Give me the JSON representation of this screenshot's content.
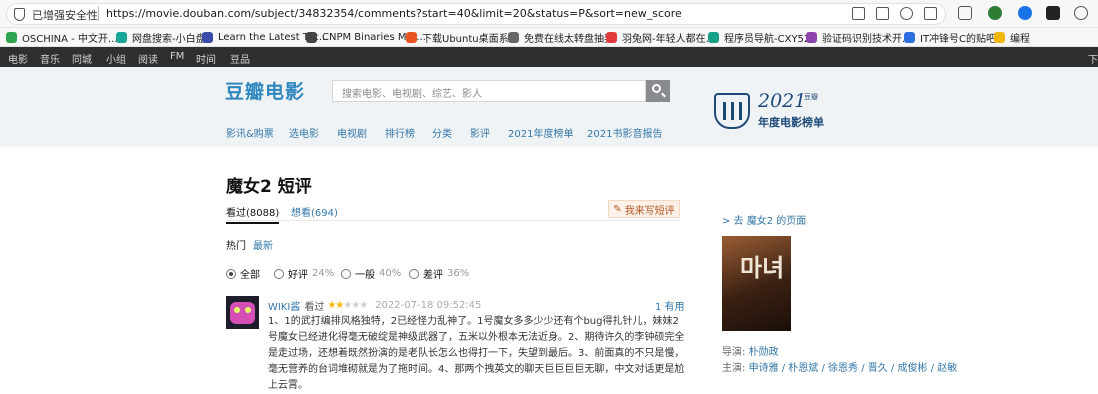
{
  "browser": {
    "security_label": "已增强安全性",
    "url": "https://movie.douban.com/subject/34832354/comments?start=40&limit=20&status=P&sort=new_score"
  },
  "bookmarks": [
    {
      "label": "OSCHINA - 中文开...",
      "color": "#2ea44f"
    },
    {
      "label": "网盘搜索-小白盘",
      "color": "#1aa69a"
    },
    {
      "label": "Learn the Latest Tec...",
      "color": "#3b4ba8"
    },
    {
      "label": "CNPM Binaries Mirr...",
      "color": "#444444"
    },
    {
      "label": "下载Ubuntu桌面系...",
      "color": "#e95420"
    },
    {
      "label": "免费在线太转盘抽奖",
      "color": "#666666"
    },
    {
      "label": "羽兔网-年轻人都在...",
      "color": "#e23b3b"
    },
    {
      "label": "程序员导航-CXY521",
      "color": "#16a085"
    },
    {
      "label": "验证码识别技术开...",
      "color": "#8e44ad"
    },
    {
      "label": "IT冲锋号C的贴吧",
      "color": "#2d6ee0"
    },
    {
      "label": "编程",
      "color": "#f2b705"
    }
  ],
  "topnav": [
    "电影",
    "音乐",
    "同城",
    "小组",
    "阅读",
    "FM",
    "时间",
    "豆品"
  ],
  "topnav_more": "下",
  "header": {
    "logo": "豆瓣电影",
    "search_placeholder": "搜索电影、电视剧、综艺、影人",
    "subnav": [
      "影讯&购票",
      "选电影",
      "电视剧",
      "排行榜",
      "分类",
      "影评",
      "2021年度榜单",
      "2021书影音报告"
    ],
    "badge_year": "2021",
    "badge_small": "豆瓣",
    "badge_text": "年度电影榜单"
  },
  "page": {
    "title": "魔女2 短评",
    "tab_watched": "看过(8088)",
    "tab_wish": "想看(694)",
    "write_button": "我来写短评",
    "sort_hot": "热门",
    "sort_new": "最新",
    "filters": [
      {
        "label": "全部",
        "pct": "",
        "checked": true
      },
      {
        "label": "好评",
        "pct": "24%",
        "checked": false
      },
      {
        "label": "一般",
        "pct": "40%",
        "checked": false
      },
      {
        "label": "差评",
        "pct": "36%",
        "checked": false
      }
    ]
  },
  "comment": {
    "user": "WIKI酱",
    "status": "看过",
    "rating": 2,
    "time": "2022-07-18 09:52:45",
    "votes": "1 有用",
    "text": "1、1的武打编排风格独特，2已经怪力乱神了。1号魔女多多少少还有个bug得扎针儿，妹妹2号魔女已经进化得毫无破绽是神级武器了，五米以外根本无法近身。2、期待许久的李钟硕完全是走过场，还想着既然扮演的是老队长怎么也得打一下，失望到最后。3、前面真的不只是慢，毫无营养的台词堆砌就是为了拖时间。4、那两个拽英文的聊天巨巨巨巨无聊，中文对话更是尬上云霄。"
  },
  "aside": {
    "back_link": "> 去 魔女2 的页面",
    "poster_glyph": "마녀",
    "director_label": "导演: ",
    "director": "朴勋政",
    "cast_label": "主演: ",
    "cast": "申诗雅 / 朴恩斌 / 徐恩秀 / 晋久 / 成俊彬 / 赵敏"
  }
}
